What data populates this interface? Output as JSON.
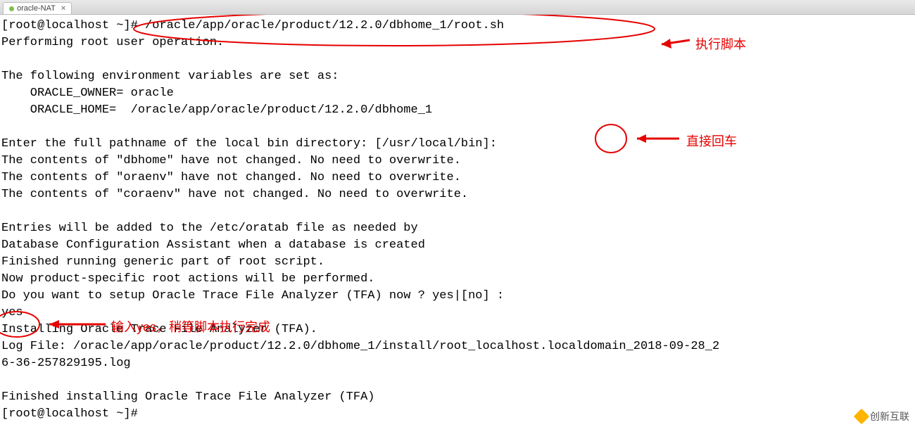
{
  "tab": {
    "title": "oracle-NAT",
    "close": "×"
  },
  "terminal": {
    "prompt": "[root@localhost ~]#",
    "command": "/oracle/app/oracle/product/12.2.0/dbhome_1/root.sh",
    "line_perform": "Performing root user operation.",
    "line_envvars": "The following environment variables are set as:",
    "line_owner": "    ORACLE_OWNER= oracle",
    "line_home": "    ORACLE_HOME=  /oracle/app/oracle/product/12.2.0/dbhome_1",
    "line_enter": "Enter the full pathname of the local bin directory: [/usr/local/bin]:",
    "line_dbhome": "The contents of \"dbhome\" have not changed. No need to overwrite.",
    "line_oraenv": "The contents of \"oraenv\" have not changed. No need to overwrite.",
    "line_coraenv": "The contents of \"coraenv\" have not changed. No need to overwrite.",
    "line_entries": "Entries will be added to the /etc/oratab file as needed by",
    "line_dca": "Database Configuration Assistant when a database is created",
    "line_finished_generic": "Finished running generic part of root script.",
    "line_product": "Now product-specific root actions will be performed.",
    "line_tfa_q": "Do you want to setup Oracle Trace File Analyzer (TFA) now ? yes|[no] :",
    "input_yes": "yes",
    "line_install": "Installing Oracle Trace File Analyzer (TFA).",
    "line_logfile": "Log File: /oracle/app/oracle/product/12.2.0/dbhome_1/install/root_localhost.localdomain_2018-09-28_2",
    "line_logfile2": "6-36-257829195.log",
    "line_finished": "Finished installing Oracle Trace File Analyzer (TFA)",
    "prompt_end": "[root@localhost ~]#"
  },
  "annotations": {
    "run_script": "执行脚本",
    "press_enter": "直接回车",
    "type_yes": "输入yes，稍等脚本执行完成"
  },
  "watermark": "创新互联"
}
